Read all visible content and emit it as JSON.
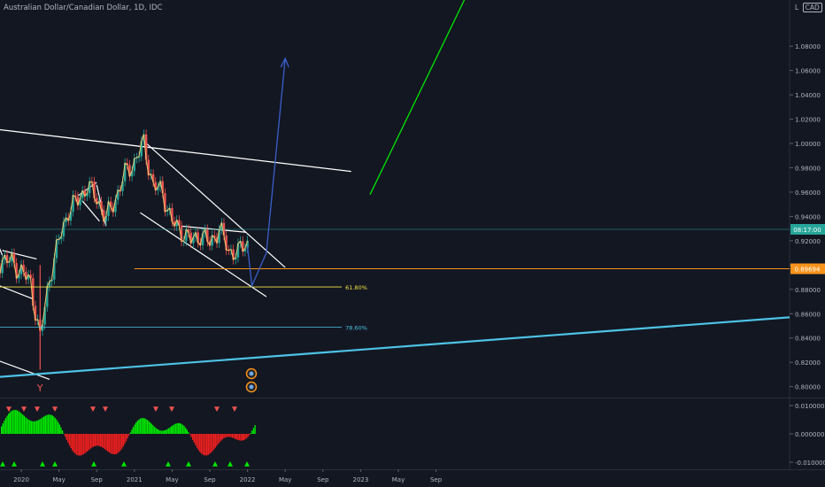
{
  "header": {
    "title": "Australian Dollar/Canadian Dollar, 1D, IDC",
    "scale_btn": "L",
    "currency_btn": "CAD"
  },
  "chart_data": {
    "type": "candlestick",
    "symbol": "AUDCAD",
    "interval": "1D",
    "source": "IDC",
    "price_axis": {
      "ticks": [
        "1.08000",
        "1.06000",
        "1.04000",
        "1.02000",
        "1.00000",
        "0.98000",
        "0.96000",
        "0.94000",
        "0.92000",
        "0.90000",
        "0.88000",
        "0.86000",
        "0.84000",
        "0.82000",
        "0.80000"
      ],
      "range": [
        0.791,
        1.118
      ]
    },
    "time_axis": {
      "ticks": [
        "2020",
        "May",
        "Sep",
        "2021",
        "May",
        "Sep",
        "2022",
        "May",
        "Sep",
        "2023",
        "May",
        "Sep"
      ]
    },
    "current_price": {
      "value": 0.89694,
      "label": "0.89694",
      "color": "#f7931a"
    },
    "countdown_label": "08:17:00",
    "price_path": [
      {
        "t": "2019-10",
        "p": 0.895
      },
      {
        "t": "2019-11",
        "p": 0.905
      },
      {
        "t": "2019-12",
        "p": 0.902
      },
      {
        "t": "2020-01",
        "p": 0.895
      },
      {
        "t": "2020-02",
        "p": 0.885
      },
      {
        "t": "2020-03",
        "p": 0.84
      },
      {
        "t": "2020-04",
        "p": 0.89
      },
      {
        "t": "2020-05",
        "p": 0.92
      },
      {
        "t": "2020-06",
        "p": 0.945
      },
      {
        "t": "2020-07",
        "p": 0.953
      },
      {
        "t": "2020-08",
        "p": 0.965
      },
      {
        "t": "2020-09",
        "p": 0.955
      },
      {
        "t": "2020-10",
        "p": 0.938
      },
      {
        "t": "2020-11",
        "p": 0.955
      },
      {
        "t": "2020-12",
        "p": 0.975
      },
      {
        "t": "2021-01",
        "p": 0.985
      },
      {
        "t": "2021-02",
        "p": 1.0
      },
      {
        "t": "2021-03",
        "p": 0.965
      },
      {
        "t": "2021-04",
        "p": 0.96
      },
      {
        "t": "2021-05",
        "p": 0.935
      },
      {
        "t": "2021-06",
        "p": 0.928
      },
      {
        "t": "2021-07",
        "p": 0.92
      },
      {
        "t": "2021-08",
        "p": 0.925
      },
      {
        "t": "2021-09",
        "p": 0.918
      },
      {
        "t": "2021-10",
        "p": 0.93
      },
      {
        "t": "2021-11",
        "p": 0.912
      },
      {
        "t": "2021-12",
        "p": 0.91
      },
      {
        "t": "2022-01",
        "p": 0.92
      }
    ],
    "fib_levels": [
      {
        "label": "61.80%",
        "value": 0.882,
        "color": "#f0e442"
      },
      {
        "label": "78.60%",
        "value": 0.849,
        "color": "#4dc3e6"
      }
    ],
    "annotations": [
      {
        "type": "text",
        "text": "Y",
        "color": "#ef5350"
      },
      {
        "type": "projection_arrow",
        "color": "#3a5fcd",
        "points": [
          {
            "t": "2022-01",
            "p": 0.915
          },
          {
            "t": "2022-01-15",
            "p": 0.883
          },
          {
            "t": "2022-03",
            "p": 0.91
          },
          {
            "t": "2022-05",
            "p": 1.07
          }
        ]
      },
      {
        "type": "line",
        "color": "#00e600"
      },
      {
        "type": "trendline",
        "color": "#ffffff"
      },
      {
        "type": "support_line",
        "color": "#4dc3e6"
      },
      {
        "type": "horizontal_line",
        "value": 0.89694,
        "color": "#f7931a"
      }
    ],
    "oscillator": {
      "ticks": [
        "0.010000",
        "0.000000",
        "-0.010000"
      ],
      "range": [
        -0.0125,
        0.0125
      ],
      "positive_color": "#00e600",
      "negative_color": "#ef1f1f"
    }
  }
}
